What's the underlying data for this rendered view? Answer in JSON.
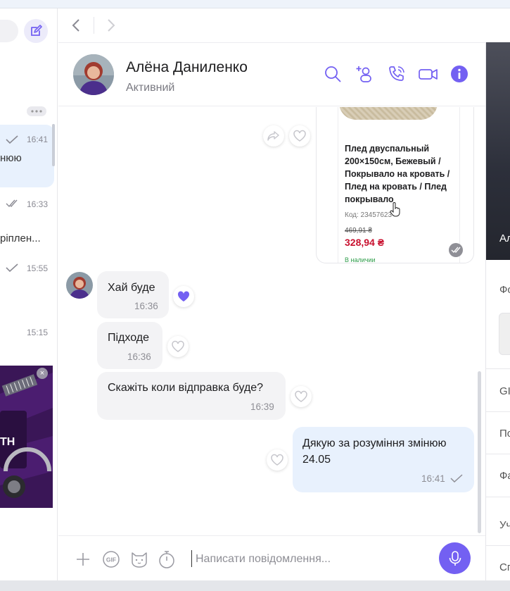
{
  "sidebar": {
    "items": [
      {
        "time": "16:41",
        "preview": "нюю",
        "status": "sent"
      },
      {
        "time": "16:33",
        "preview": "",
        "status": "read"
      },
      {
        "time": "15:55",
        "preview": "ріплен...",
        "status": "sent"
      },
      {
        "time": "15:15",
        "preview": "",
        "status": "none"
      }
    ],
    "banner_text": "ТН",
    "banner_close": "×"
  },
  "header": {
    "name": "Алёна Даниленко",
    "status": "Активний"
  },
  "product_card": {
    "title": "Плед двуспальный 200×150см, Бежевый / Покрывало на кровать / Плед на кровать / Плед покрывало",
    "code": "Код: 23457623",
    "old_price": "469,91 ₴",
    "price": "328,94 ₴",
    "stock": "В наличии"
  },
  "messages": [
    {
      "direction": "in",
      "text": "Хай буде",
      "time": "16:36",
      "reaction": "heart-filled"
    },
    {
      "direction": "in",
      "text": "Підходе",
      "time": "16:36",
      "reaction": "heart-outline"
    },
    {
      "direction": "in",
      "text": "Скажіть коли відправка буде?",
      "time": "16:39",
      "reaction": "heart-outline"
    },
    {
      "direction": "out",
      "text_line1": "Дякую за розуміння змінюю",
      "text_line2": "24.05",
      "time": "16:41",
      "reaction": "heart-outline"
    }
  ],
  "input": {
    "placeholder": "Написати повідомлення...",
    "gif_label": "GIF"
  },
  "right_panel": {
    "photo_caption": "Ал",
    "items": [
      "Фо",
      "GI",
      "По",
      "Фа",
      "Уч",
      "Сп"
    ]
  },
  "colors": {
    "accent": "#7360f2",
    "incoming_bubble": "#f3f3f5",
    "outgoing_bubble": "#e8f1fd",
    "price_red": "#c8102e"
  }
}
